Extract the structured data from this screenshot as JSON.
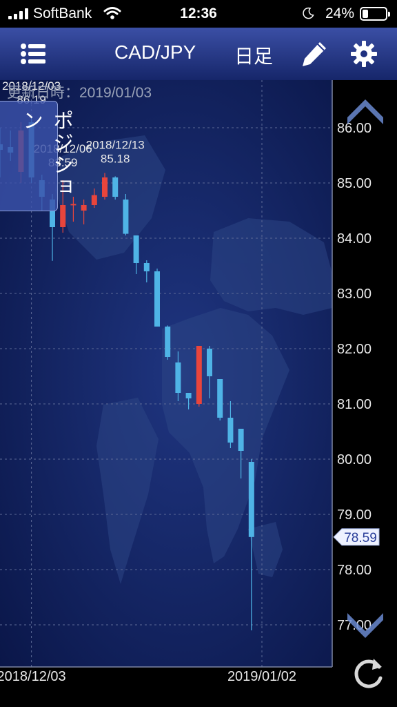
{
  "status_bar": {
    "carrier": "SoftBank",
    "time": "12:36",
    "battery": "24%",
    "battery_level": 0.24
  },
  "toolbar": {
    "title": "CAD/JPY",
    "period": "日足"
  },
  "updated_label": "更新日時：2019/01/03",
  "position_label": "ポジション",
  "colors": {
    "up": "#e8453c",
    "down": "#4fb4e6",
    "toolbar_top": "#3b4fa5",
    "toolbar_bottom": "#16266a",
    "background": "#0c1a4c"
  },
  "chart_data": {
    "type": "candlestick",
    "title": "CAD/JPY",
    "period": "日足",
    "ylim": [
      76.5,
      86.8
    ],
    "yticks": [
      "86.00",
      "85.00",
      "84.00",
      "83.00",
      "82.00",
      "81.00",
      "80.00",
      "79.00",
      "78.00",
      "77.00"
    ],
    "xtick_labels": [
      {
        "label": "2018/12/03",
        "index": 3
      },
      {
        "label": "2019/01/02",
        "index": 25
      }
    ],
    "current_price": "78.59",
    "annotations": [
      {
        "date": "2018/12/03",
        "value": "86.19",
        "index": 3
      },
      {
        "date": "2018/12/13",
        "value": "85.18",
        "index": 11
      },
      {
        "date": "2018/12/06",
        "value": "83.59",
        "index": 6
      }
    ],
    "candles": [
      {
        "open": 85.7,
        "high": 86.0,
        "low": 85.1,
        "close": 85.6
      },
      {
        "open": 85.65,
        "high": 85.95,
        "low": 85.4,
        "close": 85.55
      },
      {
        "open": 85.2,
        "high": 86.1,
        "low": 85.0,
        "close": 85.95
      },
      {
        "open": 86.1,
        "high": 86.19,
        "low": 85.0,
        "close": 85.1
      },
      {
        "open": 85.05,
        "high": 85.15,
        "low": 84.5,
        "close": 84.75
      },
      {
        "open": 84.7,
        "high": 84.8,
        "low": 83.59,
        "close": 84.2
      },
      {
        "open": 84.2,
        "high": 85.05,
        "low": 84.1,
        "close": 84.6
      },
      {
        "open": 84.6,
        "high": 84.75,
        "low": 84.3,
        "close": 84.62
      },
      {
        "open": 84.5,
        "high": 84.7,
        "low": 84.25,
        "close": 84.6
      },
      {
        "open": 84.6,
        "high": 84.9,
        "low": 84.55,
        "close": 84.78
      },
      {
        "open": 84.75,
        "high": 85.18,
        "low": 84.7,
        "close": 85.1
      },
      {
        "open": 85.1,
        "high": 85.12,
        "low": 84.7,
        "close": 84.75
      },
      {
        "open": 84.7,
        "high": 84.8,
        "low": 84.05,
        "close": 84.08
      },
      {
        "open": 84.05,
        "high": 84.05,
        "low": 83.35,
        "close": 83.55
      },
      {
        "open": 83.55,
        "high": 83.6,
        "low": 83.2,
        "close": 83.4
      },
      {
        "open": 83.4,
        "high": 83.45,
        "low": 82.4,
        "close": 82.4
      },
      {
        "open": 82.4,
        "high": 82.42,
        "low": 81.8,
        "close": 81.85
      },
      {
        "open": 81.75,
        "high": 81.95,
        "low": 81.05,
        "close": 81.2
      },
      {
        "open": 81.2,
        "high": 81.2,
        "low": 80.9,
        "close": 81.1
      },
      {
        "open": 81.0,
        "high": 82.05,
        "low": 80.95,
        "close": 82.05
      },
      {
        "open": 82.0,
        "high": 82.05,
        "low": 81.1,
        "close": 81.5
      },
      {
        "open": 81.45,
        "high": 81.45,
        "low": 80.7,
        "close": 80.75
      },
      {
        "open": 80.75,
        "high": 81.05,
        "low": 80.2,
        "close": 80.3
      },
      {
        "open": 80.55,
        "high": 80.55,
        "low": 79.65,
        "close": 80.15
      },
      {
        "open": 79.95,
        "high": 80.0,
        "low": 76.9,
        "close": 78.59
      }
    ]
  }
}
